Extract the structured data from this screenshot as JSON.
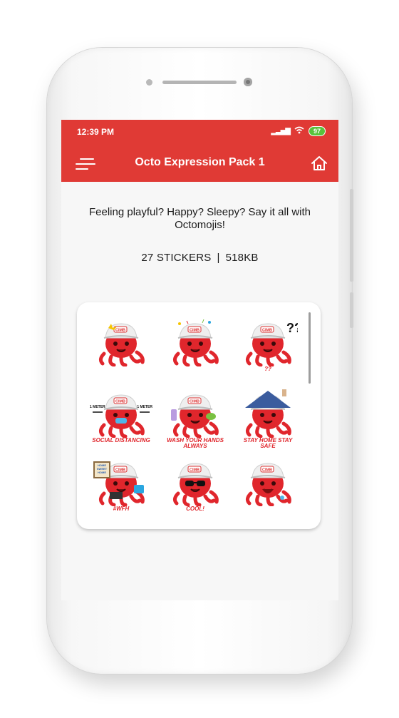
{
  "status_bar": {
    "time": "12:39 PM",
    "battery": "97"
  },
  "app_bar": {
    "title": "Octo Expression Pack 1"
  },
  "description": "Feeling playful? Happy? Sleepy? Say it all with Octomojis!",
  "meta": {
    "count": "27 STICKERS",
    "separator": "|",
    "size": "518KB"
  },
  "colors": {
    "brand": "#e03a35",
    "octo": "#e0262c"
  },
  "stickers": [
    {
      "name": "octo-dizzy",
      "caption": ""
    },
    {
      "name": "octo-party",
      "caption": ""
    },
    {
      "name": "octo-confused",
      "caption": "??"
    },
    {
      "name": "octo-social-distancing",
      "caption": "SOCIAL DISTANCING",
      "measure_left": "1 METER",
      "measure_right": "1 METER"
    },
    {
      "name": "octo-wash-hands",
      "caption": "WASH YOUR HANDS ALWAYS"
    },
    {
      "name": "octo-stay-home",
      "caption": "STAY HOME STAY SAFE"
    },
    {
      "name": "octo-wfh",
      "caption": "#WFH",
      "sign": "HOME SWEET HOME"
    },
    {
      "name": "octo-cool",
      "caption": "COOL!"
    },
    {
      "name": "octo-laugh",
      "caption": ""
    }
  ],
  "brand_logo_text": "CIMB"
}
